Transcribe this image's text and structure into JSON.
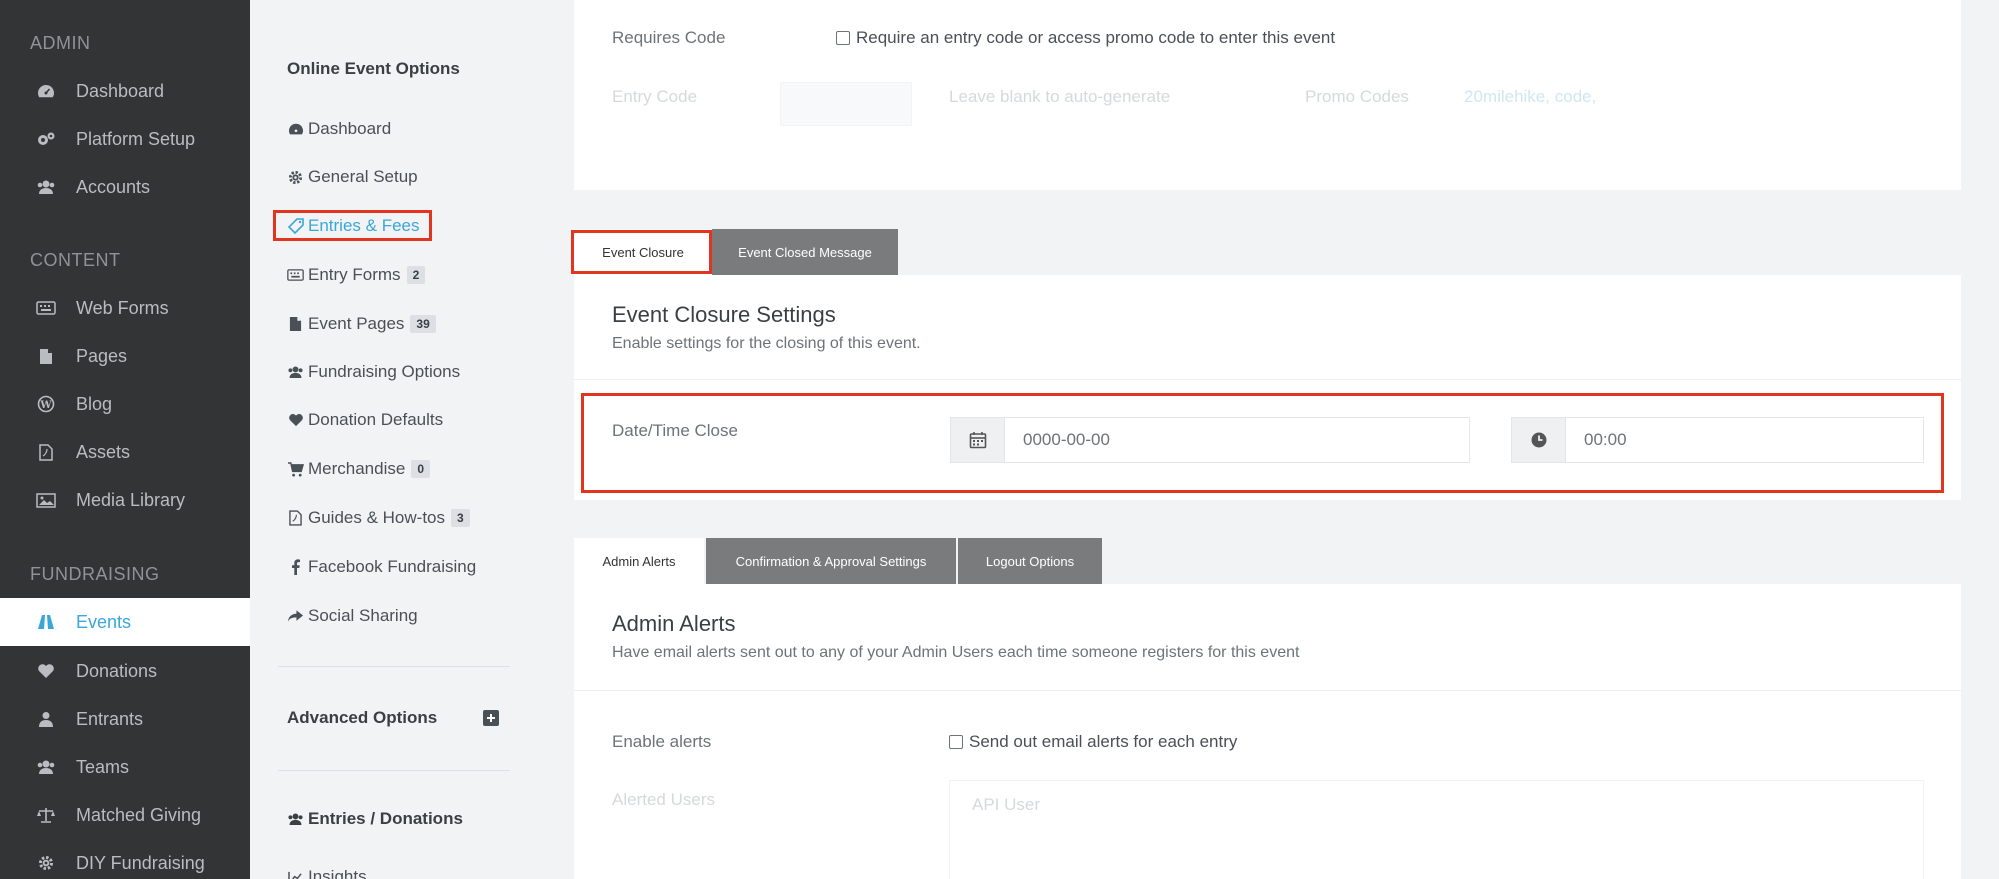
{
  "sidebar": {
    "sections": [
      {
        "label": "ADMIN"
      },
      {
        "label": "CONTENT"
      },
      {
        "label": "FUNDRAISING"
      }
    ],
    "items": [
      {
        "label": "Dashboard",
        "icon": "dashboard-icon"
      },
      {
        "label": "Platform Setup",
        "icon": "gears-icon"
      },
      {
        "label": "Accounts",
        "icon": "users-icon"
      },
      {
        "label": "Web Forms",
        "icon": "keyboard-icon"
      },
      {
        "label": "Pages",
        "icon": "file-icon"
      },
      {
        "label": "Blog",
        "icon": "wordpress-icon"
      },
      {
        "label": "Assets",
        "icon": "pdf-icon"
      },
      {
        "label": "Media Library",
        "icon": "image-icon"
      },
      {
        "label": "Events",
        "icon": "road-icon",
        "active": true
      },
      {
        "label": "Donations",
        "icon": "heart-icon"
      },
      {
        "label": "Entrants",
        "icon": "user-icon"
      },
      {
        "label": "Teams",
        "icon": "users-icon"
      },
      {
        "label": "Matched Giving",
        "icon": "balance-scale-icon"
      },
      {
        "label": "DIY Fundraising",
        "icon": "gear-icon"
      }
    ]
  },
  "menu2": {
    "heading": "Online Event Options",
    "items": [
      {
        "label": "Dashboard",
        "icon": "dashboard-icon"
      },
      {
        "label": "General Setup",
        "icon": "gear-icon"
      },
      {
        "label": "Entries & Fees",
        "icon": "ticket-icon",
        "active": true
      },
      {
        "label": "Entry Forms",
        "icon": "keyboard-icon",
        "badge": "2"
      },
      {
        "label": "Event Pages",
        "icon": "file-icon",
        "badge": "39"
      },
      {
        "label": "Fundraising Options",
        "icon": "users-icon"
      },
      {
        "label": "Donation Defaults",
        "icon": "heart-icon"
      },
      {
        "label": "Merchandise",
        "icon": "cart-icon",
        "badge": "0"
      },
      {
        "label": "Guides & How-tos",
        "icon": "pdf-icon",
        "badge": "3"
      },
      {
        "label": "Facebook Fundraising",
        "icon": "facebook-icon"
      },
      {
        "label": "Social Sharing",
        "icon": "share-icon"
      }
    ],
    "advanced": "Advanced Options",
    "entries_donations": "Entries / Donations",
    "insights": "Insights"
  },
  "code_panel": {
    "requires_code_label": "Requires Code",
    "requires_code_text": "Require an entry code or access promo code to enter this event",
    "entry_code_label": "Entry Code",
    "entry_code_hint": "Leave blank to auto-generate",
    "promo_codes_label": "Promo Codes",
    "promo_code_1": "20milehike",
    "promo_code_2": "code",
    "promo_sep": ",",
    "promo_trailing": ","
  },
  "closure_tabs": {
    "tab1": "Event Closure",
    "tab2": "Event Closed Message"
  },
  "closure_panel": {
    "title": "Event Closure Settings",
    "subtitle": "Enable settings for the closing of this event.",
    "datetime_label": "Date/Time Close",
    "date_value": "0000-00-00",
    "time_value": "00:00"
  },
  "alert_tabs": {
    "tab1": "Admin Alerts",
    "tab2": "Confirmation & Approval Settings",
    "tab3": "Logout Options"
  },
  "alerts_panel": {
    "title": "Admin Alerts",
    "subtitle": "Have email alerts sent out to any of your Admin Users each time someone registers for this event",
    "enable_label": "Enable alerts",
    "enable_text": "Send out email alerts for each entry",
    "alerted_users_label": "Alerted Users",
    "alerted_users_value": "API User"
  },
  "colors": {
    "accent": "#3aa7d8",
    "highlight": "#e1351f",
    "sidebar_bg": "#333436"
  }
}
